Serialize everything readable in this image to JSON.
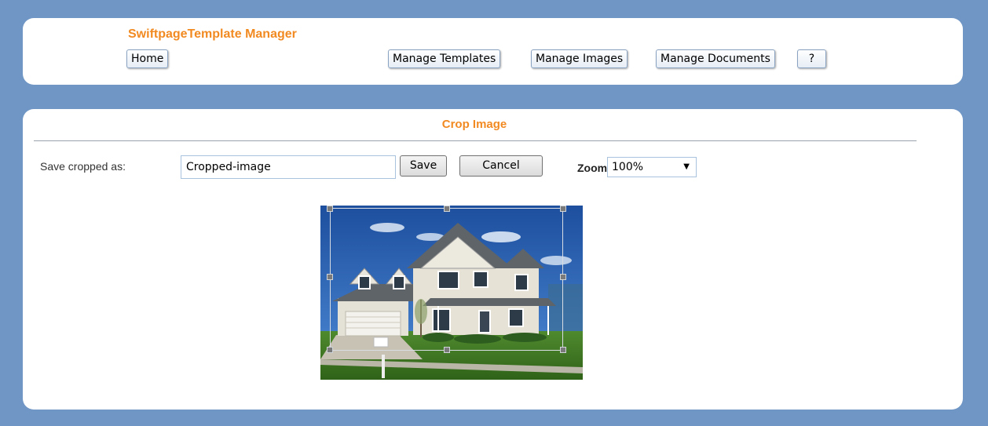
{
  "app": {
    "title": "SwiftpageTemplate Manager"
  },
  "nav": {
    "home": "Home",
    "manage_templates": "Manage Templates",
    "manage_images": "Manage Images",
    "manage_documents": "Manage Documents",
    "help": "?"
  },
  "crop": {
    "title": "Crop Image",
    "save_as_label": "Save cropped as:",
    "filename_value": "Cropped-image",
    "save_button": "Save",
    "cancel_button": "Cancel",
    "zoom_label": "Zoom:",
    "zoom_value": "100%"
  },
  "image": {
    "subject": "photo of a suburban two-story house with lawn and mailbox"
  },
  "colors": {
    "background": "#6f96c4",
    "accent": "#f28a22",
    "panel": "#ffffff"
  }
}
